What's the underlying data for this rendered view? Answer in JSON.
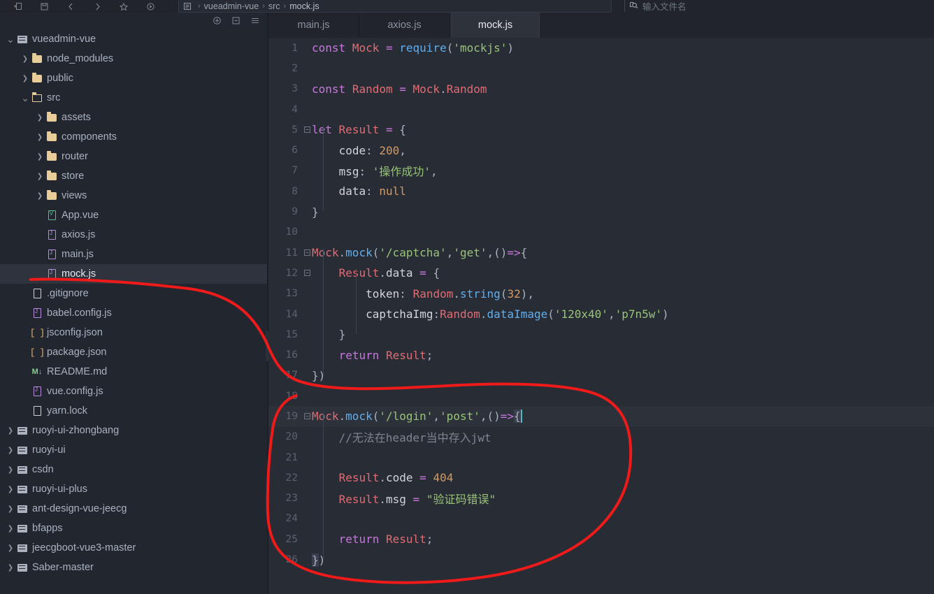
{
  "window": {
    "toolbar_icons": [
      "new-file-icon",
      "save-icon",
      "back-arrow-icon",
      "forward-arrow-icon",
      "bookmark-icon",
      "run-icon"
    ],
    "breadcrumb": {
      "segments": [
        "vueadmin-vue",
        "src",
        "mock.js"
      ],
      "separator": "›"
    },
    "search": {
      "placeholder": "输入文件名",
      "value": ""
    }
  },
  "sidebar": {
    "header_icons": [
      "add-icon",
      "collapse-all-icon",
      "menu-icon"
    ],
    "tree": [
      {
        "label": "vueadmin-vue",
        "indent": 0,
        "chev": "down",
        "icon": "project-icon",
        "selected": false
      },
      {
        "label": "node_modules",
        "indent": 1,
        "chev": "right",
        "icon": "folder-icon",
        "selected": false
      },
      {
        "label": "public",
        "indent": 1,
        "chev": "right",
        "icon": "folder-icon",
        "selected": false
      },
      {
        "label": "src",
        "indent": 1,
        "chev": "down",
        "icon": "folder-open-icon",
        "selected": false
      },
      {
        "label": "assets",
        "indent": 2,
        "chev": "right",
        "icon": "folder-icon",
        "selected": false
      },
      {
        "label": "components",
        "indent": 2,
        "chev": "right",
        "icon": "folder-icon",
        "selected": false
      },
      {
        "label": "router",
        "indent": 2,
        "chev": "right",
        "icon": "folder-icon",
        "selected": false
      },
      {
        "label": "store",
        "indent": 2,
        "chev": "right",
        "icon": "folder-icon",
        "selected": false
      },
      {
        "label": "views",
        "indent": 2,
        "chev": "right",
        "icon": "folder-icon",
        "selected": false
      },
      {
        "label": "App.vue",
        "indent": 2,
        "chev": "none",
        "icon": "vue-file-icon",
        "selected": false
      },
      {
        "label": "axios.js",
        "indent": 2,
        "chev": "none",
        "icon": "js-file-icon",
        "selected": false
      },
      {
        "label": "main.js",
        "indent": 2,
        "chev": "none",
        "icon": "js-file-icon",
        "selected": false
      },
      {
        "label": "mock.js",
        "indent": 2,
        "chev": "none",
        "icon": "js-file-icon",
        "selected": true
      },
      {
        "label": ".gitignore",
        "indent": 1,
        "chev": "none",
        "icon": "plain-file-icon",
        "selected": false
      },
      {
        "label": "babel.config.js",
        "indent": 1,
        "chev": "none",
        "icon": "js-file-icon",
        "selected": false
      },
      {
        "label": "jsconfig.json",
        "indent": 1,
        "chev": "none",
        "icon": "json-file-icon",
        "selected": false
      },
      {
        "label": "package.json",
        "indent": 1,
        "chev": "none",
        "icon": "json-file-icon",
        "selected": false
      },
      {
        "label": "README.md",
        "indent": 1,
        "chev": "none",
        "icon": "md-file-icon",
        "selected": false
      },
      {
        "label": "vue.config.js",
        "indent": 1,
        "chev": "none",
        "icon": "js-file-icon",
        "selected": false
      },
      {
        "label": "yarn.lock",
        "indent": 1,
        "chev": "none",
        "icon": "plain-file-icon",
        "selected": false
      },
      {
        "label": "ruoyi-ui-zhongbang",
        "indent": 0,
        "chev": "right",
        "icon": "project-icon",
        "selected": false
      },
      {
        "label": "ruoyi-ui",
        "indent": 0,
        "chev": "right",
        "icon": "project-icon",
        "selected": false
      },
      {
        "label": "csdn",
        "indent": 0,
        "chev": "right",
        "icon": "project-icon",
        "selected": false
      },
      {
        "label": "ruoyi-ui-plus",
        "indent": 0,
        "chev": "right",
        "icon": "project-icon",
        "selected": false
      },
      {
        "label": "ant-design-vue-jeecg",
        "indent": 0,
        "chev": "right",
        "icon": "project-icon",
        "selected": false
      },
      {
        "label": "bfapps",
        "indent": 0,
        "chev": "right",
        "icon": "project-icon",
        "selected": false
      },
      {
        "label": "jeecgboot-vue3-master",
        "indent": 0,
        "chev": "right",
        "icon": "project-icon",
        "selected": false
      },
      {
        "label": "Saber-master",
        "indent": 0,
        "chev": "right",
        "icon": "project-icon",
        "selected": false
      }
    ],
    "collapse_handle_icon": "chevron-left-icon"
  },
  "editor": {
    "tabs": [
      {
        "label": "main.js",
        "active": false
      },
      {
        "label": "axios.js",
        "active": false
      },
      {
        "label": "mock.js",
        "active": true
      }
    ],
    "active_line": 19,
    "lines": [
      {
        "n": 1,
        "fold": "",
        "text": "const Mock = require('mockjs')"
      },
      {
        "n": 2,
        "fold": "",
        "text": ""
      },
      {
        "n": 3,
        "fold": "",
        "text": "const Random = Mock.Random"
      },
      {
        "n": 4,
        "fold": "",
        "text": ""
      },
      {
        "n": 5,
        "fold": "-",
        "text": "let Result = {"
      },
      {
        "n": 6,
        "fold": "",
        "text": "    code: 200,"
      },
      {
        "n": 7,
        "fold": "",
        "text": "    msg: '操作成功',"
      },
      {
        "n": 8,
        "fold": "",
        "text": "    data: null"
      },
      {
        "n": 9,
        "fold": "",
        "text": "}"
      },
      {
        "n": 10,
        "fold": "",
        "text": ""
      },
      {
        "n": 11,
        "fold": "-",
        "text": "Mock.mock('/captcha','get',()=>{"
      },
      {
        "n": 12,
        "fold": "-",
        "text": "    Result.data = {"
      },
      {
        "n": 13,
        "fold": "",
        "text": "        token: Random.string(32),"
      },
      {
        "n": 14,
        "fold": "",
        "text": "        captchaImg:Random.dataImage('120x40','p7n5w')"
      },
      {
        "n": 15,
        "fold": "",
        "text": "    }"
      },
      {
        "n": 16,
        "fold": "",
        "text": "    return Result;"
      },
      {
        "n": 17,
        "fold": "",
        "text": "})"
      },
      {
        "n": 18,
        "fold": "",
        "text": ""
      },
      {
        "n": 19,
        "fold": "-",
        "text": "Mock.mock('/login','post',()=>{"
      },
      {
        "n": 20,
        "fold": "",
        "text": "    //无法在header当中存入jwt"
      },
      {
        "n": 21,
        "fold": "",
        "text": ""
      },
      {
        "n": 22,
        "fold": "",
        "text": "    Result.code = 404"
      },
      {
        "n": 23,
        "fold": "",
        "text": "    Result.msg = \"验证码错误\""
      },
      {
        "n": 24,
        "fold": "",
        "text": ""
      },
      {
        "n": 25,
        "fold": "",
        "text": "    return Result;"
      },
      {
        "n": 26,
        "fold": "",
        "text": "})"
      }
    ]
  },
  "annotation": {
    "type": "freehand-circle",
    "color": "#ef1a1a",
    "stroke_width": 4,
    "description": "red hand-drawn loop enclosing lines 19-26"
  },
  "colors": {
    "sidebar_bg": "#22262e",
    "editor_bg": "#282c34",
    "tabbar_bg": "#21252b",
    "active_line_bg": "#2c313a",
    "selection_bg": "#2e333d",
    "annotation_red": "#ef1a1a"
  }
}
